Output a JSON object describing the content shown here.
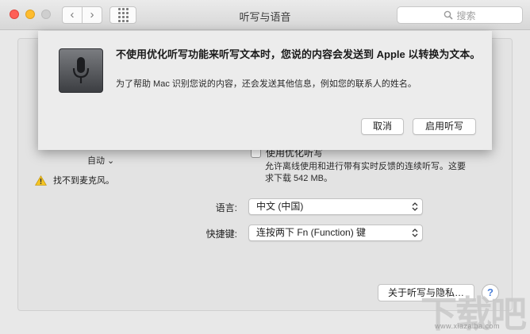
{
  "window": {
    "title": "听写与语音",
    "search_placeholder": "搜索"
  },
  "toolbar": {
    "back_icon": "chevron-left-icon",
    "forward_icon": "chevron-right-icon",
    "grid_icon": "show-all-grid-icon"
  },
  "sheet": {
    "title": "不使用优化听写功能来听写文本时，您说的内容会发送到 Apple 以转换为文本。",
    "subtitle": "为了帮助 Mac 识别您说的内容，还会发送其他信息，例如您的联系人的姓名。",
    "cancel_label": "取消",
    "enable_label": "启用听写",
    "icon": "microphone-icon"
  },
  "panel": {
    "mic_source": "自动 ⌄",
    "warning_text": "找不到麦克风。",
    "enhanced_label": "使用优化听写",
    "enhanced_desc": "允许离线使用和进行带有实时反馈的连续听写。这要求下载 542 MB。",
    "language_label": "语言:",
    "language_value": "中文 (中国)",
    "shortcut_label": "快捷键:",
    "shortcut_value": "连按两下 Fn (Function) 键",
    "about_label": "关于听写与隐私…",
    "help_label": "?"
  },
  "watermark": {
    "text": "www.xiazaiba.com",
    "mark": "下载吧"
  },
  "colors": {
    "close": "#fe5f57",
    "minimize": "#febc2e",
    "help_accent": "#4a7fd8"
  }
}
